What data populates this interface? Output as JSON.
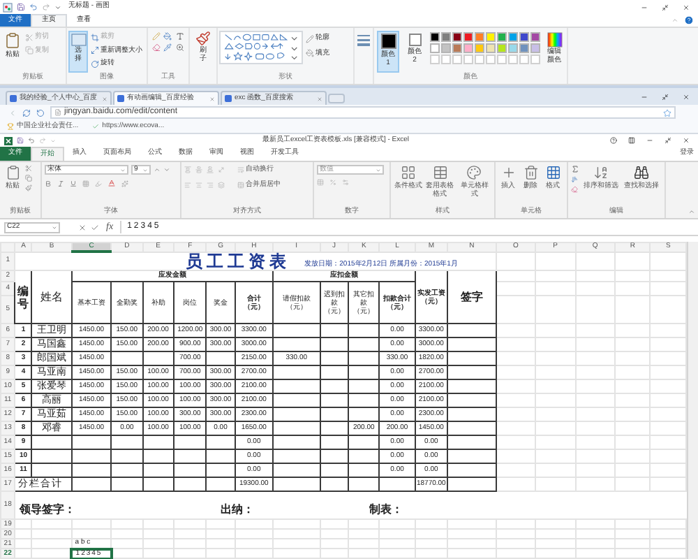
{
  "paint": {
    "title": "无标题 - 画图",
    "tabs": [
      {
        "label": "文件",
        "kind": "file",
        "selected": false
      },
      {
        "label": "主页",
        "kind": "tab",
        "selected": true
      },
      {
        "label": "查看",
        "kind": "tab",
        "selected": false
      }
    ],
    "clipboard": {
      "paste": "粘贴",
      "group": "剪贴板",
      "items": [
        {
          "kind": "cut",
          "label": "剪切",
          "disabled": true
        },
        {
          "kind": "copy",
          "label": "复制",
          "disabled": true
        }
      ]
    },
    "image": {
      "select": {
        "label": "选择",
        "selected": true
      },
      "group": "图像",
      "items": [
        {
          "kind": "crop",
          "label": "裁剪",
          "disabled": true
        },
        {
          "kind": "resize",
          "label": "重新调整大小",
          "disabled": false
        },
        {
          "kind": "rotate",
          "label": "旋转",
          "disabled": false
        }
      ]
    },
    "tools": {
      "group": "工具"
    },
    "brush": "刷子",
    "shapes": {
      "group": "形状",
      "outline": "轮廓",
      "fill": "填充"
    },
    "color1": {
      "label": "颜色 1",
      "color": "#000000",
      "selected": true
    },
    "color2": {
      "label": "颜色 2",
      "color": "#ffffff",
      "selected": false
    },
    "palette": [
      {
        "color": "#000000"
      },
      {
        "color": "#7f7f7f"
      },
      {
        "color": "#880015"
      },
      {
        "color": "#ed1c24"
      },
      {
        "color": "#ff7f27"
      },
      {
        "color": "#fff200"
      },
      {
        "color": "#22b14c"
      },
      {
        "color": "#00a2e8"
      },
      {
        "color": "#3f48cc"
      },
      {
        "color": "#a349a4"
      },
      {
        "color": "#ffffff"
      },
      {
        "color": "#c3c3c3"
      },
      {
        "color": "#b97a57"
      },
      {
        "color": "#ffaec9"
      },
      {
        "color": "#ffc90e"
      },
      {
        "color": "#efe4b0"
      },
      {
        "color": "#b5e61d"
      },
      {
        "color": "#99d9ea"
      },
      {
        "color": "#7092be"
      },
      {
        "color": "#c8bfe7"
      }
    ],
    "edit_colors": "编辑颜色",
    "colors_group": "颜色"
  },
  "browser": {
    "tabs": [
      {
        "label": "我的经验_个人中心_百度",
        "selected": false
      },
      {
        "label": "有动画编辑_百度经验",
        "selected": true
      },
      {
        "label": "exc 函数_百度搜索",
        "selected": false
      }
    ],
    "address": "jingyan.baidu.com/edit/content",
    "bookmarks": [
      {
        "kind": "trophy",
        "label": "中国企业社会责任..."
      },
      {
        "kind": "check",
        "label": "https://www.ecova..."
      }
    ]
  },
  "excel": {
    "title": "最新员工excel工资表模板.xls  [兼容模式] - Excel",
    "tabs": [
      {
        "label": "文件",
        "kind": "file",
        "selected": false
      },
      {
        "label": "开始",
        "kind": "tab",
        "selected": true
      },
      {
        "label": "插入",
        "kind": "tab",
        "selected": false
      },
      {
        "label": "页面布局",
        "kind": "tab",
        "selected": false
      },
      {
        "label": "公式",
        "kind": "tab",
        "selected": false
      },
      {
        "label": "数据",
        "kind": "tab",
        "selected": false
      },
      {
        "label": "审阅",
        "kind": "tab",
        "selected": false
      },
      {
        "label": "视图",
        "kind": "tab",
        "selected": false
      },
      {
        "label": "开发工具",
        "kind": "tab",
        "selected": false
      }
    ],
    "sign_in": "登录",
    "ribbon": {
      "paste": "粘贴",
      "clipboard_group": "剪贴板",
      "font": "宋体",
      "size": "9",
      "font_group": "字体",
      "wrap": "自动换行",
      "merge": "合并后居中",
      "align_group": "对齐方式",
      "number_format": "数值",
      "number_group": "数字",
      "conditional": "条件格式",
      "table_format": "套用表格格式",
      "cell_styles": "单元格样式",
      "styles_group": "样式",
      "insert": "插入",
      "delete": "删除",
      "format": "格式",
      "cells_group": "单元格",
      "sort": "排序和筛选",
      "find": "查找和选择",
      "edit_group": "编辑"
    },
    "formula_bar": {
      "name_box": "C22",
      "fx": "fx",
      "value": "12345"
    },
    "sheet": {
      "columns": [
        {
          "letter": "A",
          "selected": false
        },
        {
          "letter": "B",
          "selected": false
        },
        {
          "letter": "C",
          "selected": true
        },
        {
          "letter": "D",
          "selected": false
        },
        {
          "letter": "E",
          "selected": false
        },
        {
          "letter": "F",
          "selected": false
        },
        {
          "letter": "G",
          "selected": false
        },
        {
          "letter": "H",
          "selected": false
        },
        {
          "letter": "I",
          "selected": false
        },
        {
          "letter": "J",
          "selected": false
        },
        {
          "letter": "K",
          "selected": false
        },
        {
          "letter": "L",
          "selected": false
        },
        {
          "letter": "M",
          "selected": false
        },
        {
          "letter": "N",
          "selected": false
        },
        {
          "letter": "O",
          "selected": false
        },
        {
          "letter": "P",
          "selected": false
        },
        {
          "letter": "Q",
          "selected": false
        },
        {
          "letter": "R",
          "selected": false
        },
        {
          "letter": "S",
          "selected": false
        }
      ],
      "title_row": "1",
      "title": "员工工资表",
      "date": "发放日期：2015年2月12日  所属月份：2015年1月",
      "header_rows": [
        "2",
        "4",
        "5"
      ],
      "headers": {
        "no": "编号",
        "name": "姓名",
        "payable": "应发金额",
        "deduct": "应扣金额",
        "net": "实发工资（元）",
        "sign": "签字",
        "payable_cols": [
          "基本工资",
          "全勤奖",
          "补助",
          "岗位",
          "奖金",
          "合计（元）"
        ],
        "deduct_cols": [
          "请假扣款（元）",
          "迟到扣款（元）",
          "其它扣款（元）",
          "扣款合计（元）"
        ]
      },
      "rows": [
        {
          "row": "6",
          "cells": [
            "1",
            "王卫明",
            "1450.00",
            "150.00",
            "200.00",
            "1200.00",
            "300.00",
            "3300.00",
            null,
            null,
            null,
            "0.00",
            "3300.00"
          ]
        },
        {
          "row": "7",
          "cells": [
            "2",
            "马国鑫",
            "1450.00",
            "150.00",
            "200.00",
            "900.00",
            "300.00",
            "3000.00",
            null,
            null,
            null,
            "0.00",
            "3000.00"
          ]
        },
        {
          "row": "8",
          "cells": [
            "3",
            "郎国斌",
            "1450.00",
            null,
            null,
            "700.00",
            null,
            "2150.00",
            "330.00",
            null,
            null,
            "330.00",
            "1820.00"
          ]
        },
        {
          "row": "9",
          "cells": [
            "4",
            "马亚南",
            "1450.00",
            "150.00",
            "100.00",
            "700.00",
            "300.00",
            "2700.00",
            null,
            null,
            null,
            "0.00",
            "2700.00"
          ]
        },
        {
          "row": "10",
          "cells": [
            "5",
            "张爱琴",
            "1450.00",
            "150.00",
            "100.00",
            "100.00",
            "300.00",
            "2100.00",
            null,
            null,
            null,
            "0.00",
            "2100.00"
          ]
        },
        {
          "row": "11",
          "cells": [
            "6",
            "高丽",
            "1450.00",
            "150.00",
            "100.00",
            "100.00",
            "300.00",
            "2100.00",
            null,
            null,
            null,
            "0.00",
            "2100.00"
          ]
        },
        {
          "row": "12",
          "cells": [
            "7",
            "马亚茹",
            "1450.00",
            "150.00",
            "100.00",
            "300.00",
            "300.00",
            "2300.00",
            null,
            null,
            null,
            "0.00",
            "2300.00"
          ]
        },
        {
          "row": "13",
          "cells": [
            "8",
            "邓睿",
            "1450.00",
            "0.00",
            "100.00",
            "100.00",
            "0.00",
            "1650.00",
            null,
            null,
            "200.00",
            "200.00",
            "1450.00"
          ]
        },
        {
          "row": "14",
          "cells": [
            "9",
            null,
            null,
            null,
            null,
            null,
            null,
            "0.00",
            null,
            null,
            null,
            "0.00",
            "0.00"
          ]
        },
        {
          "row": "15",
          "cells": [
            "10",
            null,
            null,
            null,
            null,
            null,
            null,
            "0.00",
            null,
            null,
            null,
            "0.00",
            "0.00"
          ]
        },
        {
          "row": "16",
          "cells": [
            "11",
            null,
            null,
            null,
            null,
            null,
            null,
            "0.00",
            null,
            null,
            null,
            "0.00",
            "0.00"
          ]
        }
      ],
      "total": {
        "row": "17",
        "label": "分栏合计",
        "total": "19300.00",
        "net": "18770.00"
      },
      "footer": {
        "row": "18",
        "leader": "领导签字：",
        "cashier": "出纳：",
        "maker": "制表："
      },
      "extra_rows": [
        {
          "row": "19",
          "selected": false
        },
        {
          "row": "20",
          "selected": false
        },
        {
          "row": "21",
          "c": "a b c",
          "selected": false
        },
        {
          "row": "22",
          "c": "12345",
          "selected": true
        }
      ]
    }
  }
}
